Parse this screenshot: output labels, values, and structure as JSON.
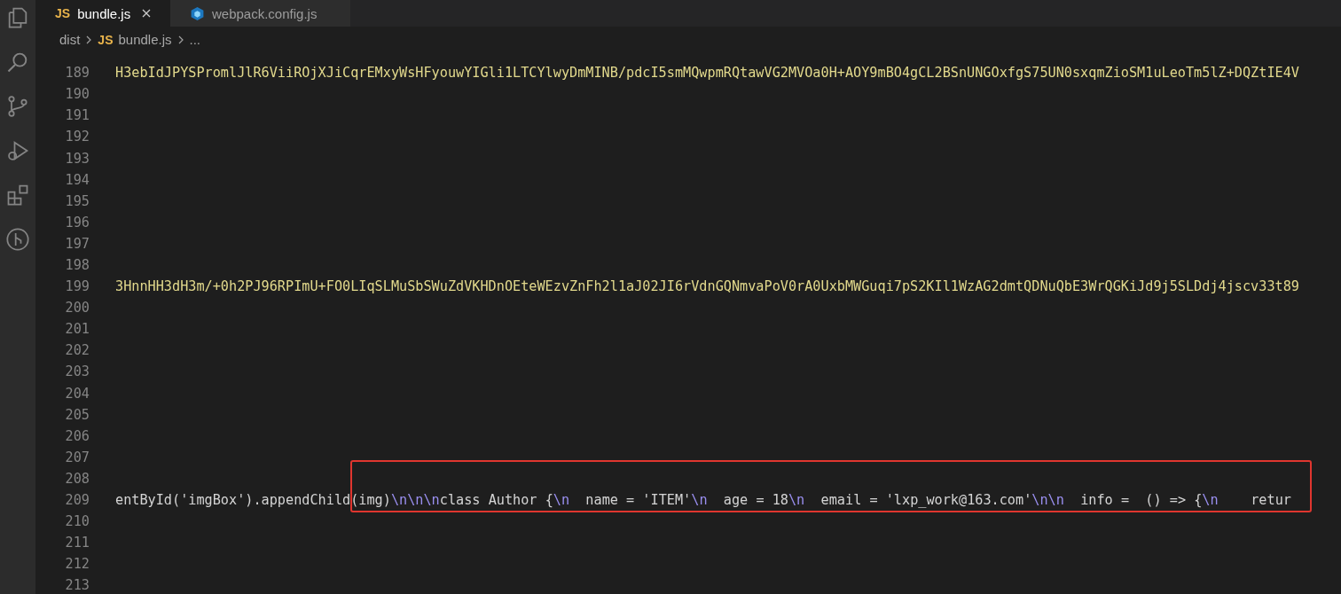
{
  "tabs": [
    {
      "label": "bundle.js",
      "badge": "JS",
      "selected": true,
      "closable": true
    },
    {
      "label": "webpack.config.js",
      "selected": false,
      "closable": false
    }
  ],
  "breadcrumbs": [
    {
      "label": "dist"
    },
    {
      "label": "bundle.js",
      "badge": "JS"
    },
    {
      "label": "..."
    }
  ],
  "editor": {
    "lines": [
      {
        "number": "189",
        "highlighted": false,
        "segments": [
          {
            "kind": "string",
            "text": "H3ebIdJPYSPromlJlR6ViiROjXJiCqrEMxyWsHFyouwYIGli1LTCYlwyDmMINB/pdcI5smMQwpmRQtawVG2MVOa0H+AOY9mBO4gCL2BSnUNGOxfgS75UN0sxqmZioSM1uLeoTm5lZ+DQZtIE4V"
          }
        ]
      },
      {
        "number": "190",
        "highlighted": false
      },
      {
        "number": "191",
        "highlighted": false
      },
      {
        "number": "192",
        "highlighted": false
      },
      {
        "number": "193",
        "highlighted": false
      },
      {
        "number": "194",
        "highlighted": false
      },
      {
        "number": "195",
        "highlighted": false
      },
      {
        "number": "196",
        "highlighted": false
      },
      {
        "number": "197",
        "highlighted": false
      },
      {
        "number": "198",
        "highlighted": false
      },
      {
        "number": "199",
        "highlighted": false,
        "segments": [
          {
            "kind": "string",
            "text": "3HnnHH3dH3m/+0h2PJ96RPImU+FO0LIqSLMuSbSWuZdVKHDnOEteWEzvZnFh2l1aJ02JI6rVdnGQNmvaPoV0rA0UxbMWGuqi7pS2KIl1WzAG2dmtQDNuQbE3WrQGKiJd9j5SLDdj4jscv33t89"
          }
        ]
      },
      {
        "number": "200",
        "highlighted": false
      },
      {
        "number": "201",
        "highlighted": false
      },
      {
        "number": "202",
        "highlighted": false
      },
      {
        "number": "203",
        "highlighted": false
      },
      {
        "number": "204",
        "highlighted": false
      },
      {
        "number": "205",
        "highlighted": false
      },
      {
        "number": "206",
        "highlighted": false
      },
      {
        "number": "207",
        "highlighted": false
      },
      {
        "number": "208",
        "highlighted": false
      },
      {
        "number": "209",
        "highlighted": true,
        "segments": [
          {
            "kind": "plain",
            "text": "entById('imgBox').appendChild(img)"
          },
          {
            "kind": "escape",
            "text": "\\n\\n\\n"
          },
          {
            "kind": "plain",
            "text": "class Author {"
          },
          {
            "kind": "escape",
            "text": "\\n"
          },
          {
            "kind": "plain",
            "text": "  name = 'ITEM'"
          },
          {
            "kind": "escape",
            "text": "\\n"
          },
          {
            "kind": "plain",
            "text": "  age = 18"
          },
          {
            "kind": "escape",
            "text": "\\n"
          },
          {
            "kind": "plain",
            "text": "  email = 'lxp_work@163.com'"
          },
          {
            "kind": "escape",
            "text": "\\n\\n"
          },
          {
            "kind": "plain",
            "text": "  info =  () => {"
          },
          {
            "kind": "escape",
            "text": "\\n"
          },
          {
            "kind": "plain",
            "text": "    retur"
          }
        ]
      },
      {
        "number": "210",
        "highlighted": false
      },
      {
        "number": "211",
        "highlighted": false
      },
      {
        "number": "212",
        "highlighted": false
      },
      {
        "number": "213",
        "highlighted": false
      }
    ]
  }
}
